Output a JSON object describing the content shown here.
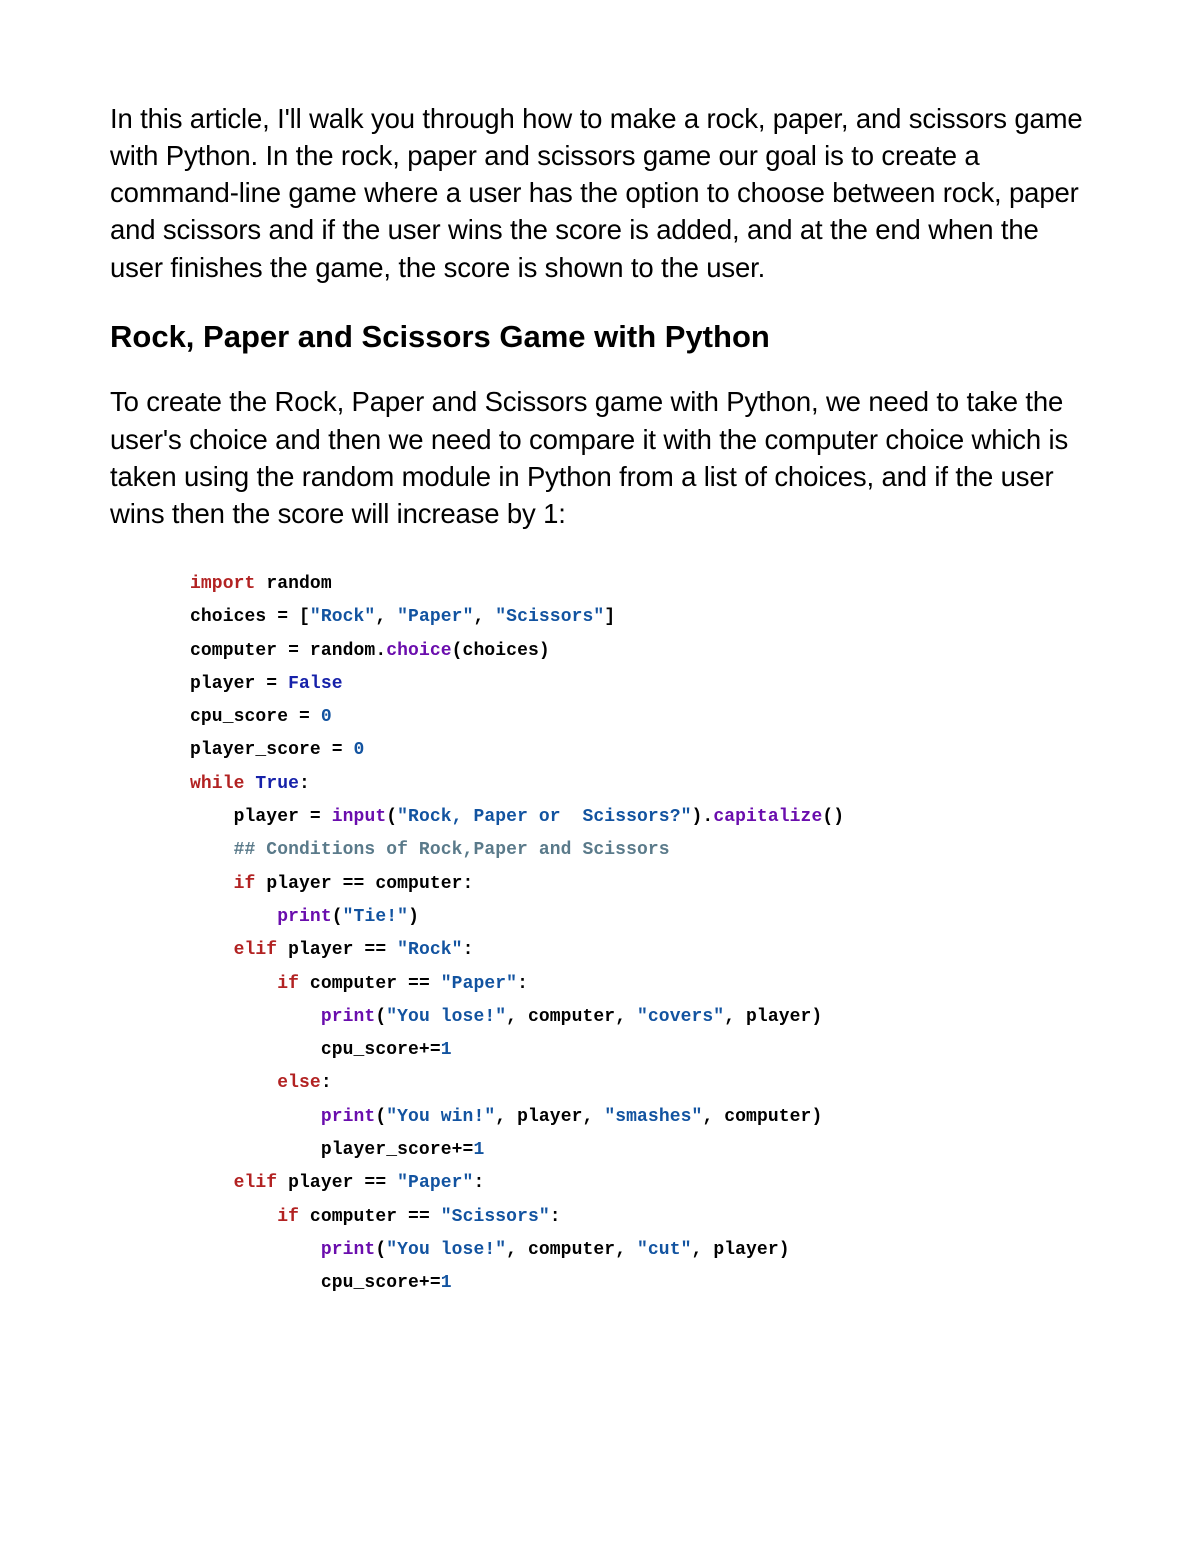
{
  "intro_paragraph": "In this article, I'll walk you through how to make a rock, paper, and scissors game with Python. In the rock, paper and scissors game our goal is to create a command-line game where a user has the option to choose between rock, paper and scissors and if the user wins the score is added, and at the end when the user finishes the game, the score is shown to the user.",
  "heading": "Rock, Paper and Scissors Game with Python",
  "second_paragraph": "To create the Rock, Paper and Scissors game with Python, we need to take the user's choice and then we need to compare it with the computer choice which is taken using the random module in Python from a list of choices, and if the user wins then the score will increase by 1:",
  "code": {
    "l1_import": "import",
    "l1_random": " random",
    "l2_a": "choices = [",
    "l2_s1": "\"Rock\"",
    "l2_c1": ", ",
    "l2_s2": "\"Paper\"",
    "l2_c2": ", ",
    "l2_s3": "\"Scissors\"",
    "l2_b": "]",
    "l3_a": "computer = random.",
    "l3_fn": "choice",
    "l3_b": "(choices)",
    "l4_a": "player = ",
    "l4_v": "False",
    "l5_a": "cpu_score = ",
    "l5_v": "0",
    "l6_a": "player_score = ",
    "l6_v": "0",
    "l7_kw": "while",
    "l7_sp": " ",
    "l7_v": "True",
    "l7_c": ":",
    "l8_a": "    player = ",
    "l8_fn1": "input",
    "l8_p1": "(",
    "l8_s": "\"Rock, Paper or  Scissors?\"",
    "l8_p2": ").",
    "l8_fn2": "capitalize",
    "l8_p3": "()",
    "l9_cmt": "    ## Conditions of Rock,Paper and Scissors",
    "l10_kw": "    if",
    "l10_b": " player == computer:",
    "l11_a": "        ",
    "l11_fn": "print",
    "l11_p1": "(",
    "l11_s": "\"Tie!\"",
    "l11_p2": ")",
    "l12_kw": "    elif",
    "l12_a": " player == ",
    "l12_s": "\"Rock\"",
    "l12_c": ":",
    "l13_kw": "        if",
    "l13_a": " computer == ",
    "l13_s": "\"Paper\"",
    "l13_c": ":",
    "l14_a": "            ",
    "l14_fn": "print",
    "l14_p1": "(",
    "l14_s1": "\"You lose!\"",
    "l14_c1": ", computer, ",
    "l14_s2": "\"covers\"",
    "l14_c2": ", player)",
    "l15_a": "            cpu_score+=",
    "l15_v": "1",
    "l16_kw": "        else",
    "l16_c": ":",
    "l17_a": "            ",
    "l17_fn": "print",
    "l17_p1": "(",
    "l17_s1": "\"You win!\"",
    "l17_c1": ", player, ",
    "l17_s2": "\"smashes\"",
    "l17_c2": ", computer)",
    "l18_a": "            player_score+=",
    "l18_v": "1",
    "l19_kw": "    elif",
    "l19_a": " player == ",
    "l19_s": "\"Paper\"",
    "l19_c": ":",
    "l20_kw": "        if",
    "l20_a": " computer == ",
    "l20_s": "\"Scissors\"",
    "l20_c": ":",
    "l21_a": "            ",
    "l21_fn": "print",
    "l21_p1": "(",
    "l21_s1": "\"You lose!\"",
    "l21_c1": ", computer, ",
    "l21_s2": "\"cut\"",
    "l21_c2": ", player)",
    "l22_a": "            cpu_score+=",
    "l22_v": "1"
  }
}
